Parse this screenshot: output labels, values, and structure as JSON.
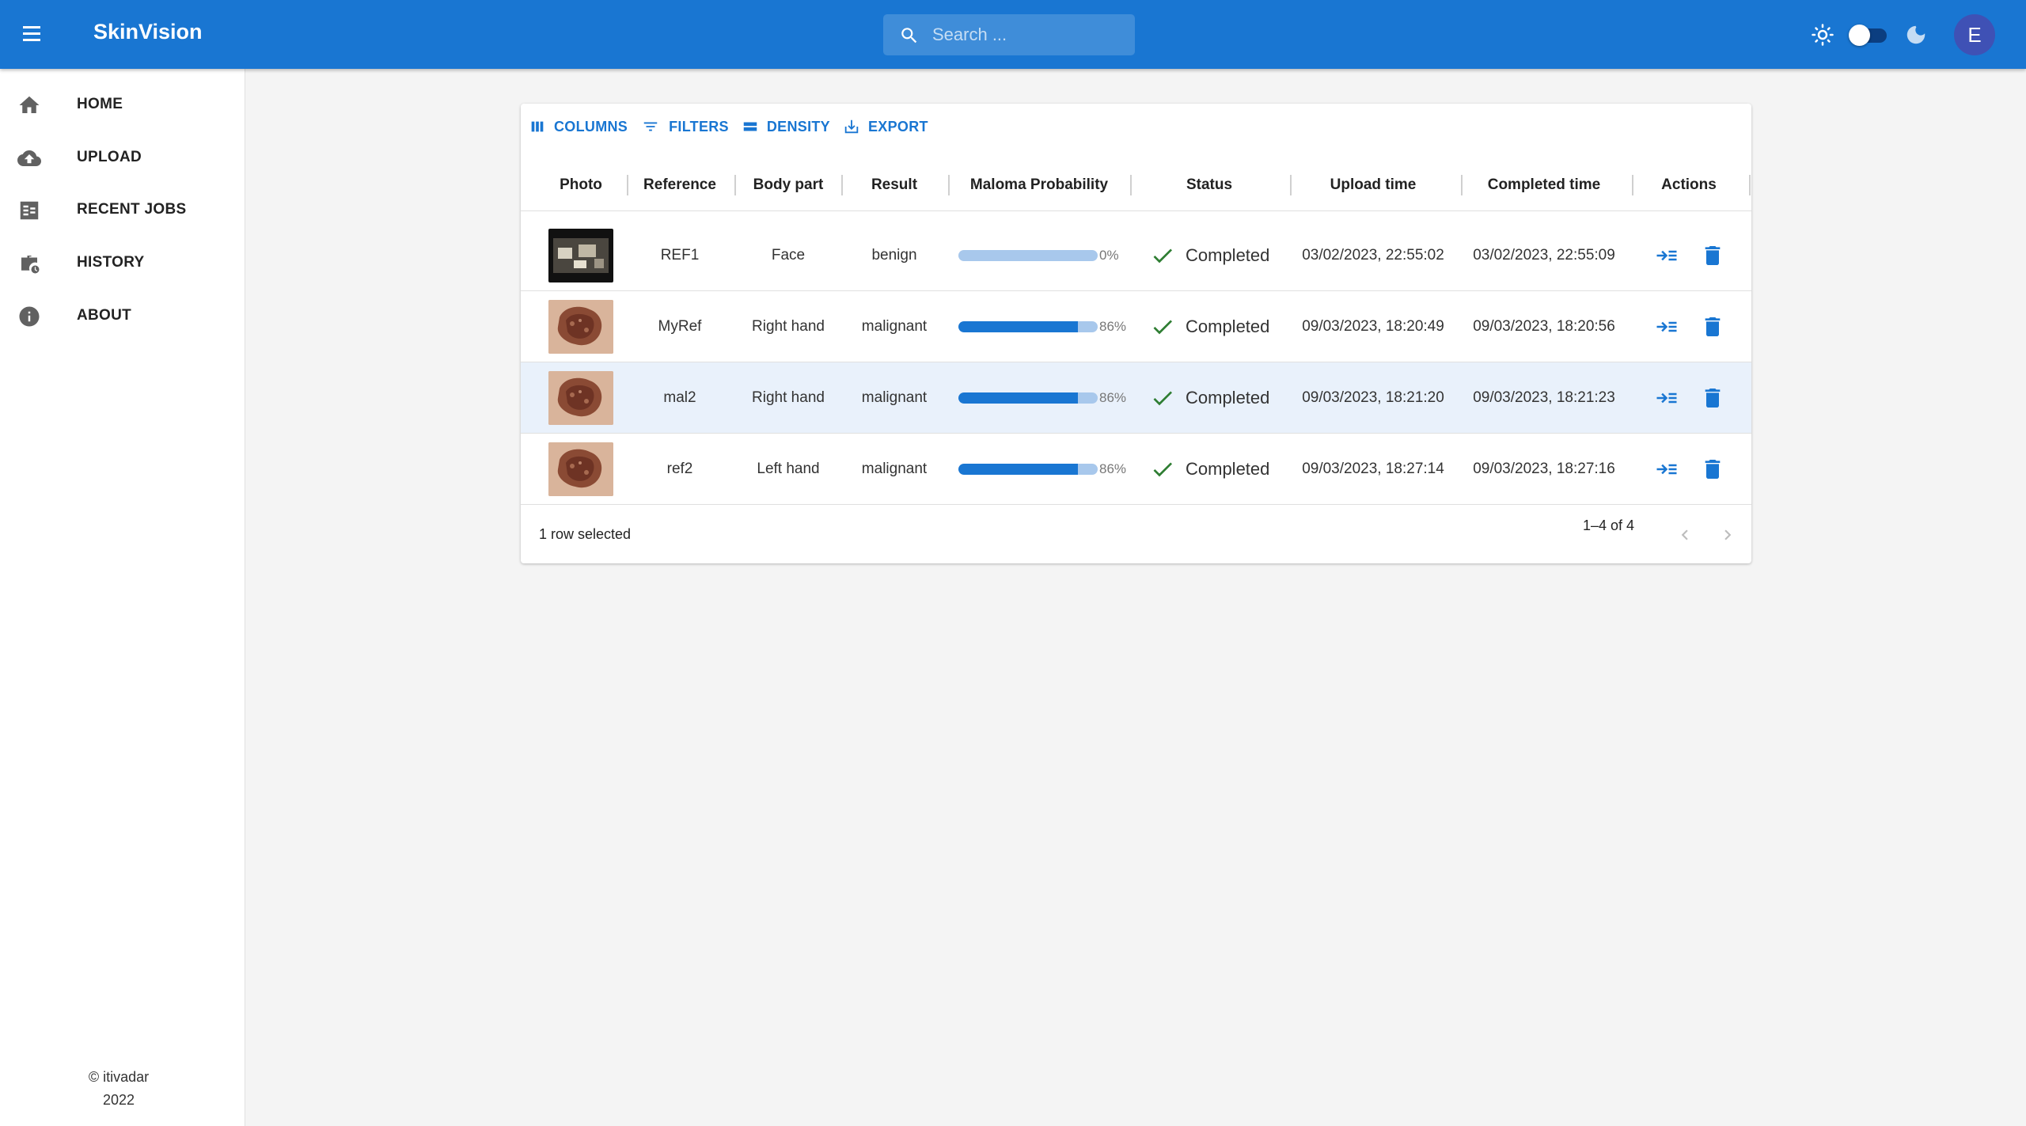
{
  "app": {
    "title": "SkinVision",
    "search_placeholder": "Search ...",
    "avatar_initial": "E",
    "accent": "#1976d2",
    "theme_toggle": "light"
  },
  "sidebar": {
    "items": [
      {
        "label": "HOME",
        "icon": "home-icon"
      },
      {
        "label": "UPLOAD",
        "icon": "cloud-upload-icon"
      },
      {
        "label": "RECENT JOBS",
        "icon": "recent-jobs-icon"
      },
      {
        "label": "HISTORY",
        "icon": "history-icon"
      },
      {
        "label": "ABOUT",
        "icon": "info-icon"
      }
    ],
    "copyright_line1": "© itivadar",
    "copyright_line2": "2022"
  },
  "toolbar": {
    "columns": "COLUMNS",
    "filters": "FILTERS",
    "density": "DENSITY",
    "export": "EXPORT"
  },
  "table": {
    "headers": {
      "photo": "Photo",
      "reference": "Reference",
      "body_part": "Body part",
      "result": "Result",
      "probability": "Maloma Probability",
      "status": "Status",
      "upload_time": "Upload time",
      "completed_time": "Completed time",
      "actions": "Actions"
    },
    "rows": [
      {
        "photo": "dark-photo",
        "reference": "REF1",
        "body_part": "Face",
        "result": "benign",
        "probability": 0,
        "probability_label": "0%",
        "status": "Completed",
        "upload_time": "03/02/2023, 22:55:02",
        "completed_time": "03/02/2023, 22:55:09",
        "selected": false
      },
      {
        "photo": "mole-photo",
        "reference": "MyRef",
        "body_part": "Right hand",
        "result": "malignant",
        "probability": 86,
        "probability_label": "86%",
        "status": "Completed",
        "upload_time": "09/03/2023, 18:20:49",
        "completed_time": "09/03/2023, 18:20:56",
        "selected": false
      },
      {
        "photo": "mole-photo",
        "reference": "mal2",
        "body_part": "Right hand",
        "result": "malignant",
        "probability": 86,
        "probability_label": "86%",
        "status": "Completed",
        "upload_time": "09/03/2023, 18:21:20",
        "completed_time": "09/03/2023, 18:21:23",
        "selected": true
      },
      {
        "photo": "mole-photo",
        "reference": "ref2",
        "body_part": "Left hand",
        "result": "malignant",
        "probability": 86,
        "probability_label": "86%",
        "status": "Completed",
        "upload_time": "09/03/2023, 18:27:14",
        "completed_time": "09/03/2023, 18:27:16",
        "selected": false
      }
    ],
    "selection_text": "1 row selected",
    "page_info": "1–4 of 4"
  }
}
